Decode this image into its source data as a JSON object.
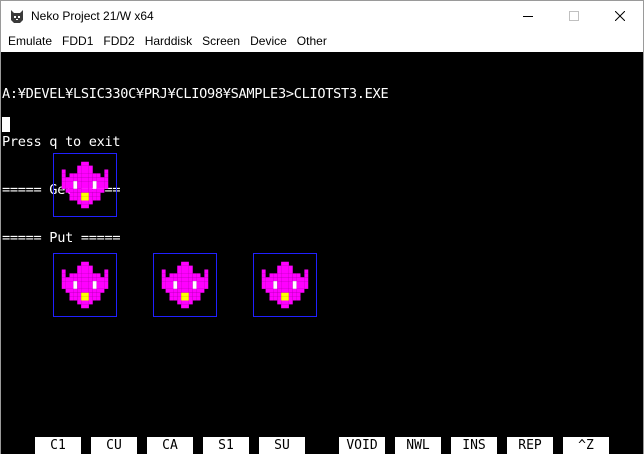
{
  "window": {
    "title": "Neko Project 21/W x64",
    "app_icon": "cat-icon",
    "controls": {
      "minimize": "minimize-icon",
      "maximize": "maximize-icon",
      "close": "close-icon"
    }
  },
  "menu": {
    "items": [
      {
        "label": "Emulate"
      },
      {
        "label": "FDD1"
      },
      {
        "label": "FDD2"
      },
      {
        "label": "Harddisk"
      },
      {
        "label": "Screen"
      },
      {
        "label": "Device"
      },
      {
        "label": "Other"
      }
    ]
  },
  "terminal": {
    "lines": [
      "A:¥DEVEL¥LSIC330C¥PRJ¥CLIO98¥SAMPLE3>CLIOTST3.EXE",
      "Press q to exit",
      "===== Get =====",
      "===== Put ====="
    ]
  },
  "sprites": {
    "count": 4,
    "colors": {
      "body": "#ff00ff",
      "eyes": "#ffffff",
      "mouth": "#ffff00",
      "frame": "#2020ff",
      "background": "#000000"
    }
  },
  "function_keys": [
    {
      "label": "C1"
    },
    {
      "label": "CU"
    },
    {
      "label": "CA"
    },
    {
      "label": "S1"
    },
    {
      "label": "SU"
    },
    {
      "label": "VOID"
    },
    {
      "label": "NWL"
    },
    {
      "label": "INS"
    },
    {
      "label": "REP"
    },
    {
      "label": "^Z"
    }
  ]
}
